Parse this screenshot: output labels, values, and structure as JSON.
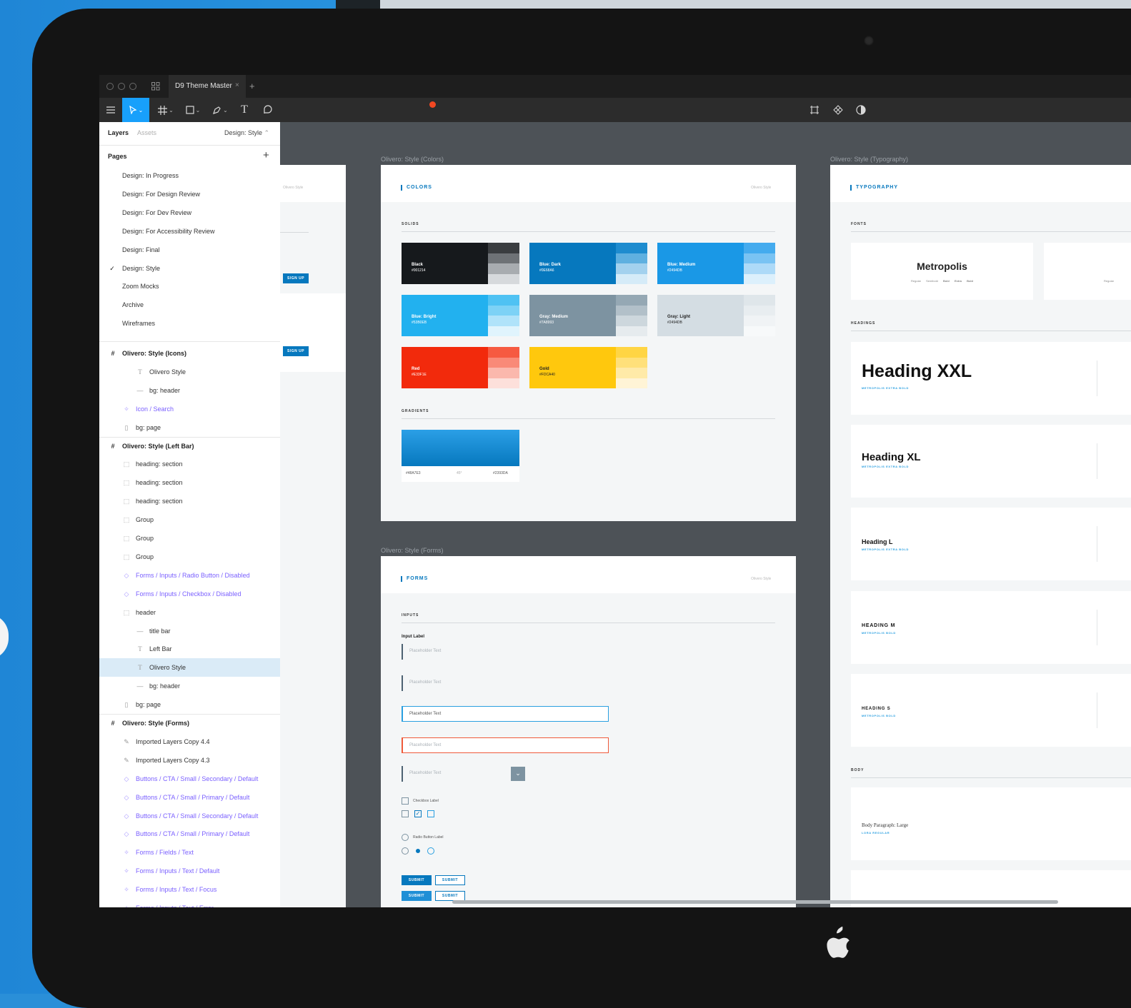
{
  "window": {
    "tab_title": "D9 Theme Master",
    "tab_close": "×",
    "new_tab": "+"
  },
  "toolbar": {
    "move_tool": "move-tool",
    "frame_tool": "frame-tool",
    "shape_tool": "rectangle-tool",
    "pen_tool": "pen-tool",
    "text_tool": "T",
    "comment_tool": "comment-tool",
    "notification_color": "#F24822",
    "accent": "#18A0FB"
  },
  "layers_panel": {
    "tab_layers": "Layers",
    "tab_assets": "Assets",
    "current_page": "Design: Style",
    "pages_heading": "Pages",
    "pages": [
      "Design: In Progress",
      "Design: For Design Review",
      "Design: For Dev Review",
      "Design: For Accessibility Review",
      "Design: Final",
      "Design: Style",
      "Zoom Mocks",
      "Archive",
      "Wireframes"
    ],
    "layers": [
      {
        "label": "Olivero: Style (Icons)",
        "icon": "frame-icon",
        "kind": "frame"
      },
      {
        "label": "Olivero Style",
        "icon": "text-icon",
        "kind": "layer"
      },
      {
        "label": "bg: header",
        "icon": "line-icon",
        "kind": "layer"
      },
      {
        "label": "Icon / Search",
        "icon": "component-icon",
        "kind": "component"
      },
      {
        "label": "bg: page",
        "icon": "rectangle-icon",
        "kind": "layer"
      },
      {
        "label": "Olivero: Style (Left Bar)",
        "icon": "frame-icon",
        "kind": "frame"
      },
      {
        "label": "heading: section",
        "icon": "group-icon",
        "kind": "layer"
      },
      {
        "label": "heading: section",
        "icon": "group-icon",
        "kind": "layer"
      },
      {
        "label": "heading: section",
        "icon": "group-icon",
        "kind": "layer"
      },
      {
        "label": "Group",
        "icon": "group-icon",
        "kind": "layer"
      },
      {
        "label": "Group",
        "icon": "group-icon",
        "kind": "layer"
      },
      {
        "label": "Group",
        "icon": "group-icon",
        "kind": "layer"
      },
      {
        "label": "Forms / Inputs / Radio Button / Disabled",
        "icon": "instance-icon",
        "kind": "component"
      },
      {
        "label": "Forms / Inputs / Checkbox / Disabled",
        "icon": "instance-icon",
        "kind": "component"
      },
      {
        "label": "header",
        "icon": "group-icon",
        "kind": "layer"
      },
      {
        "label": "title bar",
        "icon": "line-icon",
        "kind": "layer"
      },
      {
        "label": "Left Bar",
        "icon": "text-icon",
        "kind": "layer"
      },
      {
        "label": "Olivero Style",
        "icon": "text-icon",
        "kind": "layer",
        "selected": true
      },
      {
        "label": "bg: header",
        "icon": "line-icon",
        "kind": "layer"
      },
      {
        "label": "bg: page",
        "icon": "rectangle-icon",
        "kind": "layer"
      },
      {
        "label": "Olivero: Style (Forms)",
        "icon": "frame-icon",
        "kind": "frame"
      },
      {
        "label": "Imported Layers Copy 4.4",
        "icon": "vector-icon",
        "kind": "layer"
      },
      {
        "label": "Imported Layers Copy 4.3",
        "icon": "vector-icon",
        "kind": "layer"
      },
      {
        "label": "Buttons / CTA / Small / Secondary / Default",
        "icon": "instance-icon",
        "kind": "component"
      },
      {
        "label": "Buttons / CTA / Small / Primary / Default",
        "icon": "instance-icon",
        "kind": "component"
      },
      {
        "label": "Buttons / CTA / Small / Secondary / Default",
        "icon": "instance-icon",
        "kind": "component"
      },
      {
        "label": "Buttons / CTA / Small / Primary / Default",
        "icon": "instance-icon",
        "kind": "component"
      },
      {
        "label": "Forms / Fields / Text",
        "icon": "component-icon",
        "kind": "component"
      },
      {
        "label": "Forms / Inputs / Text / Default",
        "icon": "component-icon",
        "kind": "component"
      },
      {
        "label": "Forms / Inputs / Text / Focus",
        "icon": "component-icon",
        "kind": "component"
      },
      {
        "label": "Forms / Inputs / Text / Error",
        "icon": "component-icon",
        "kind": "component"
      }
    ]
  },
  "canvas": {
    "partial_frame": {
      "brand": "Olivero Style",
      "button": "SIGN UP"
    },
    "colors_frame": {
      "frame_label": "Olivero: Style (Colors)",
      "title": "COLORS",
      "brand": "Olivero Style",
      "solids_heading": "SOLIDS",
      "gradients_heading": "GRADIENTS",
      "swatches": [
        {
          "name": "Black",
          "hex": "#001214",
          "color": "#16191c",
          "tints": [
            "#3a3d40",
            "#6e7276",
            "#a8acb0",
            "#d6d9dc"
          ],
          "text": "#ffffff"
        },
        {
          "name": "Blue: Dark",
          "hex": "#0E68A6",
          "color": "#0678be",
          "tints": [
            "#1e8ccf",
            "#5fb0e0",
            "#a3d1ee",
            "#d5ebf8"
          ],
          "text": "#ffffff"
        },
        {
          "name": "Blue: Medium",
          "hex": "#2494DB",
          "color": "#1a98e6",
          "tints": [
            "#44abee",
            "#79c3f3",
            "#addaf8",
            "#dcf0fc"
          ],
          "text": "#ffffff"
        },
        {
          "name": "Blue: Bright",
          "hex": "#53B0EB",
          "color": "#22b1ef",
          "tints": [
            "#4fc2f3",
            "#7dd2f6",
            "#b0e3fa",
            "#e0f4fd"
          ],
          "text": "#ffffff"
        },
        {
          "name": "Gray: Medium",
          "hex": "#7A8993",
          "color": "#7d93a1",
          "tints": [
            "#95a8b4",
            "#b2c0c9",
            "#cdd7dd",
            "#e6ebee"
          ],
          "text": "#ffffff"
        },
        {
          "name": "Gray: Light",
          "hex": "#2494DB",
          "color": "#d4dde3",
          "tints": [
            "#dfe6ea",
            "#e8edf0",
            "#f0f3f5",
            "#f7f9fa"
          ],
          "text": "#222222"
        },
        {
          "name": "Red",
          "hex": "#E33F1E",
          "color": "#f22a0c",
          "tints": [
            "#f65a41",
            "#f98a78",
            "#fbb8ad",
            "#fde0db"
          ],
          "text": "#ffffff"
        },
        {
          "name": "Gold",
          "hex": "#FDCA40",
          "color": "#ffc80d",
          "tints": [
            "#ffd544",
            "#ffe07a",
            "#ffeaa8",
            "#fff4d6"
          ],
          "text": "#222222"
        }
      ],
      "gradient": {
        "start": "#48A7E3",
        "angle": "45°",
        "end": "#2393DA"
      }
    },
    "forms_frame": {
      "frame_label": "Olivero: Style (Forms)",
      "title": "FORMS",
      "brand": "Olivero Style",
      "inputs_heading": "INPUTS",
      "input_label": "Input Label",
      "placeholder": "Placeholder Text",
      "checkbox_label": "Checkbox Label",
      "radio_label": "Radio Button Label",
      "submit": "SUBMIT"
    },
    "typography_frame": {
      "frame_label": "Olivero: Style (Typography)",
      "title": "TYPOGRAPHY",
      "fonts_heading": "FONTS",
      "font_name": "Metropolis",
      "font_weights": [
        "Regular",
        "Semibold",
        "Bold",
        "Extra Bold"
      ],
      "second_font_weight": "Regular",
      "headings_heading": "HEADINGS",
      "headings": [
        {
          "text": "Heading XXL",
          "spec": "METROPOLIS EXTRA BOLD"
        },
        {
          "text": "Heading XL",
          "spec": "METROPOLIS EXTRA BOLD"
        },
        {
          "text": "Heading L",
          "spec": "METROPOLIS EXTRA BOLD"
        },
        {
          "text": "HEADING M",
          "spec": "METROPOLIS BOLD"
        },
        {
          "text": "HEADING S",
          "spec": "METROPOLIS BOLD"
        }
      ],
      "body_heading": "BODY",
      "body_sample": "Body Paragraph: Large",
      "body_spec": "LORA REGULAR"
    }
  }
}
